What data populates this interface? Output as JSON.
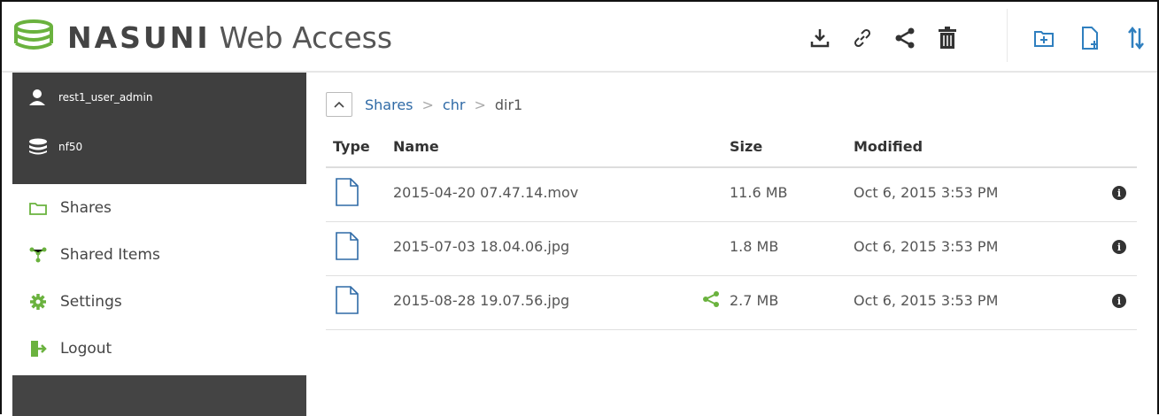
{
  "header": {
    "brand": "NASUNI",
    "product": "Web Access",
    "toolbar": [
      {
        "name": "download-icon",
        "tooltip": ""
      },
      {
        "name": "link-icon",
        "tooltip": ""
      },
      {
        "name": "share-icon",
        "tooltip": ""
      },
      {
        "name": "trash-icon",
        "tooltip": ""
      }
    ],
    "toolbar_right": [
      {
        "name": "new-folder-icon"
      },
      {
        "name": "new-file-icon"
      },
      {
        "name": "sort-icon"
      }
    ]
  },
  "sidebar": {
    "user": "rest1_user_admin",
    "filer": "nf50",
    "items": [
      {
        "label": "Shares",
        "icon": "folder-icon"
      },
      {
        "label": "Shared Items",
        "icon": "shared-items-icon"
      },
      {
        "label": "Settings",
        "icon": "gear-icon"
      },
      {
        "label": "Logout",
        "icon": "logout-icon"
      }
    ]
  },
  "breadcrumb": {
    "items": [
      "Shares",
      "chr"
    ],
    "current": "dir1"
  },
  "table": {
    "headers": {
      "type": "Type",
      "name": "Name",
      "size": "Size",
      "modified": "Modified"
    },
    "rows": [
      {
        "name": "2015-04-20 07.47.14.mov",
        "size": "11.6 MB",
        "modified": "Oct 6, 2015 3:53 PM",
        "shared": false
      },
      {
        "name": "2015-07-03 18.04.06.jpg",
        "size": "1.8 MB",
        "modified": "Oct 6, 2015 3:53 PM",
        "shared": false
      },
      {
        "name": "2015-08-28 19.07.56.jpg",
        "size": "2.7 MB",
        "modified": "Oct 6, 2015 3:53 PM",
        "shared": true
      }
    ]
  },
  "colors": {
    "accent_green": "#6ab23e",
    "file_icon_blue": "#2f6aa6",
    "sidebar_dark": "#444444"
  }
}
